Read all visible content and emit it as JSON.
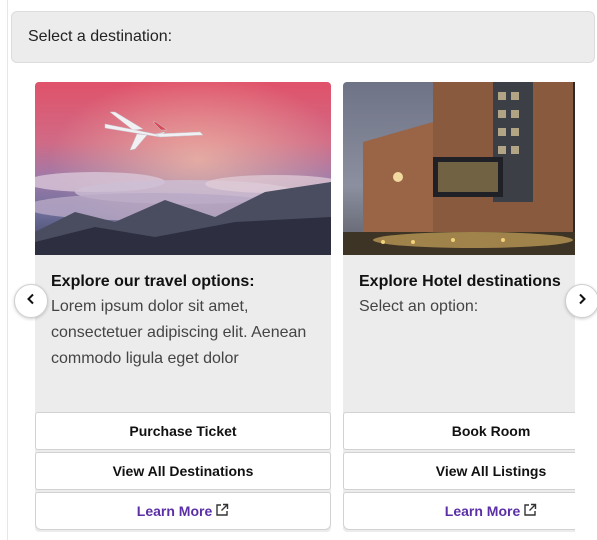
{
  "prompt": {
    "label": "Select a destination:"
  },
  "carousel": {
    "prev_icon": "chevron-left-icon",
    "next_icon": "chevron-right-icon",
    "cards": [
      {
        "image": "airplane-over-clouds-sunset",
        "title": "Explore our travel options:",
        "text": "Lorem ipsum dolor sit amet, consectetuer adipiscing elit. Aenean commodo ligula eget dolor",
        "actions": [
          {
            "label": "Purchase Ticket"
          },
          {
            "label": "View All Destinations"
          },
          {
            "label": "Learn More",
            "icon": "external-link-icon"
          }
        ]
      },
      {
        "image": "hotel-building-night",
        "title": "Explore Hotel destinations",
        "text": "Select an option:",
        "actions": [
          {
            "label": "Book Room"
          },
          {
            "label": "View All Listings"
          },
          {
            "label": "Learn More",
            "icon": "external-link-icon"
          }
        ]
      }
    ]
  },
  "colors": {
    "link": "#5b2fa5",
    "card_bg": "#ececec",
    "prompt_bg": "#ececec"
  }
}
